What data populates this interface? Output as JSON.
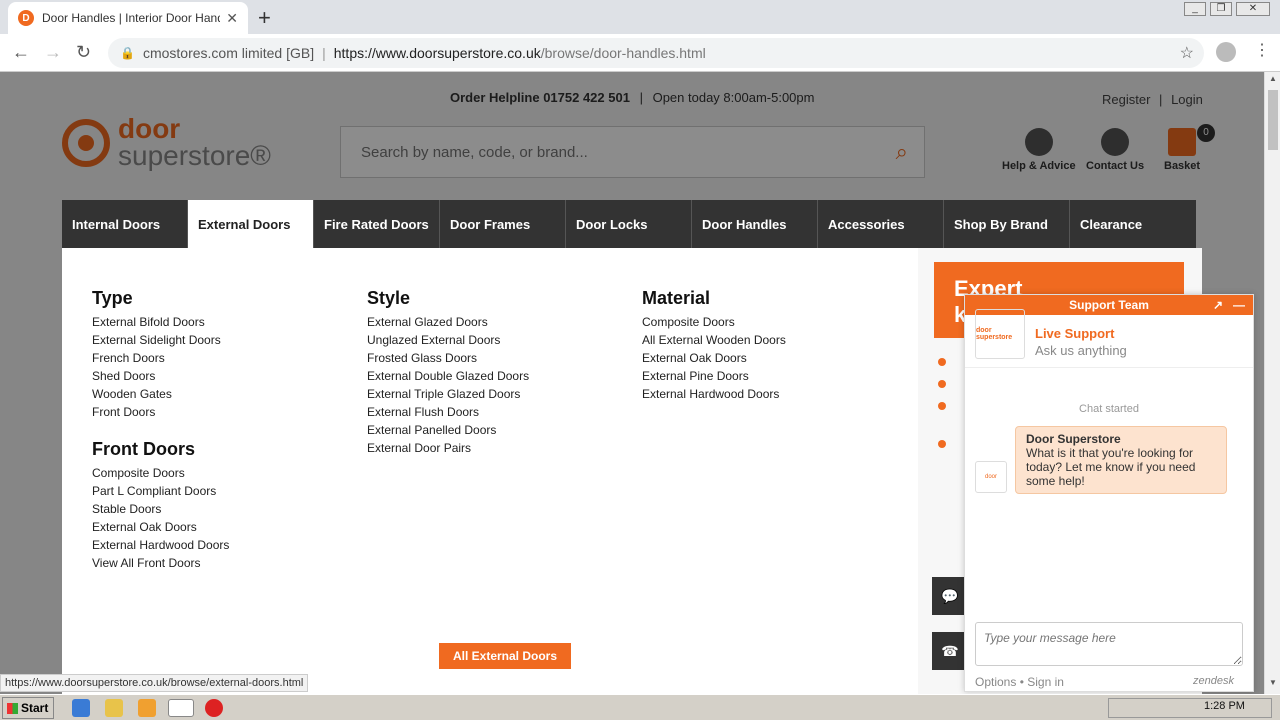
{
  "browser": {
    "tab_title": "Door Handles | Interior Door Handle",
    "url_prefix": "cmostores.com limited [GB]",
    "url_host": "https://www.doorsuperstore.co.uk",
    "url_path": "/browse/door-handles.html",
    "status_url": "https://www.doorsuperstore.co.uk/browse/external-doors.html"
  },
  "header": {
    "helpline_label": "Order Helpline 01752 422 501",
    "hours": "Open today 8:00am-5:00pm",
    "register": "Register",
    "login": "Login",
    "logo_line1": "door",
    "logo_line2": "superstore®",
    "search_placeholder": "Search by name, code, or brand...",
    "help_label": "Help & Advice",
    "contact_label": "Contact Us",
    "basket_label": "Basket",
    "basket_count": "0"
  },
  "nav": [
    "Internal Doors",
    "External Doors",
    "Fire Rated Doors",
    "Door Frames",
    "Door Locks",
    "Door Handles",
    "Accessories",
    "Shop By Brand",
    "Clearance"
  ],
  "mega": {
    "type_title": "Type",
    "type_links": [
      "External Bifold Doors",
      "External Sidelight Doors",
      "French Doors",
      "Shed Doors",
      "Wooden Gates",
      "Front Doors"
    ],
    "front_title": "Front Doors",
    "front_links": [
      "Composite Doors",
      "Part L Compliant Doors",
      "Stable Doors",
      "External Oak Doors",
      "External Hardwood Doors",
      "View All Front Doors"
    ],
    "style_title": "Style",
    "style_links": [
      "External Glazed Doors",
      "Unglazed External Doors",
      "Frosted Glass Doors",
      "External Double Glazed Doors",
      "External Triple Glazed Doors",
      "External Flush Doors",
      "External Panelled Doors",
      "External Door Pairs"
    ],
    "material_title": "Material",
    "material_links": [
      "Composite Doors",
      "All External Wooden Doors",
      "External Oak Doors",
      "External Pine Doors",
      "External Hardwood Doors"
    ],
    "all_button": "All External Doors"
  },
  "promo": {
    "banner_text": "Expert\nk"
  },
  "chat": {
    "header": "Support Team",
    "agent_name": "Live Support",
    "agent_sub": "Ask us anything",
    "started": "Chat started",
    "msg_from": "Door Superstore",
    "msg_text": "What is it that you're looking for today? Let me know if you need some help!",
    "input_placeholder": "Type your message here",
    "options": "Options • Sign in",
    "brand": "zendesk"
  },
  "taskbar": {
    "start": "Start",
    "clock": "1:28 PM"
  },
  "colors": {
    "accent": "#f06a20",
    "nav_bg": "#333333"
  }
}
